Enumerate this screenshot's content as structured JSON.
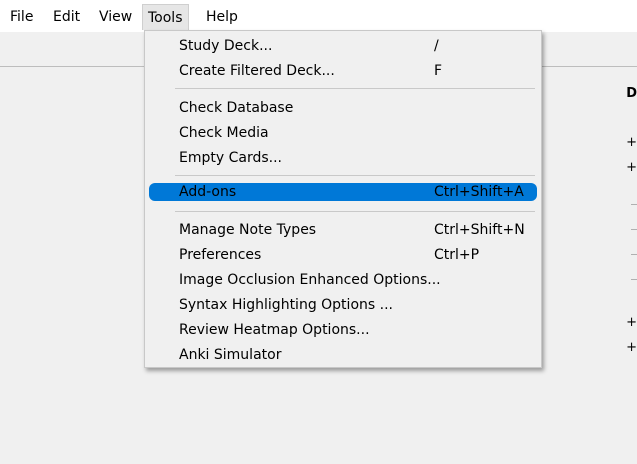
{
  "menubar": {
    "items": [
      {
        "label": "File"
      },
      {
        "label": "Edit"
      },
      {
        "label": "View"
      },
      {
        "label": "Tools"
      },
      {
        "label": "Help"
      }
    ]
  },
  "tools_menu": {
    "highlight_color": "#0078d7",
    "items": [
      {
        "label": "Study Deck...",
        "shortcut": "/"
      },
      {
        "label": "Create Filtered Deck...",
        "shortcut": "F"
      },
      {
        "label": "Check Database",
        "shortcut": ""
      },
      {
        "label": "Check Media",
        "shortcut": ""
      },
      {
        "label": "Empty Cards...",
        "shortcut": ""
      },
      {
        "label": "Add-ons",
        "shortcut": "Ctrl+Shift+A"
      },
      {
        "label": "Manage Note Types",
        "shortcut": "Ctrl+Shift+N"
      },
      {
        "label": "Preferences",
        "shortcut": "Ctrl+P"
      },
      {
        "label": "Image Occlusion Enhanced Options...",
        "shortcut": ""
      },
      {
        "label": "Syntax Highlighting Options ...",
        "shortcut": ""
      },
      {
        "label": "Review Heatmap Options...",
        "shortcut": ""
      },
      {
        "label": "Anki Simulator",
        "shortcut": ""
      }
    ]
  },
  "background": {
    "right_edge_glyphs": [
      "D",
      "+",
      "+",
      "+",
      "+"
    ]
  }
}
